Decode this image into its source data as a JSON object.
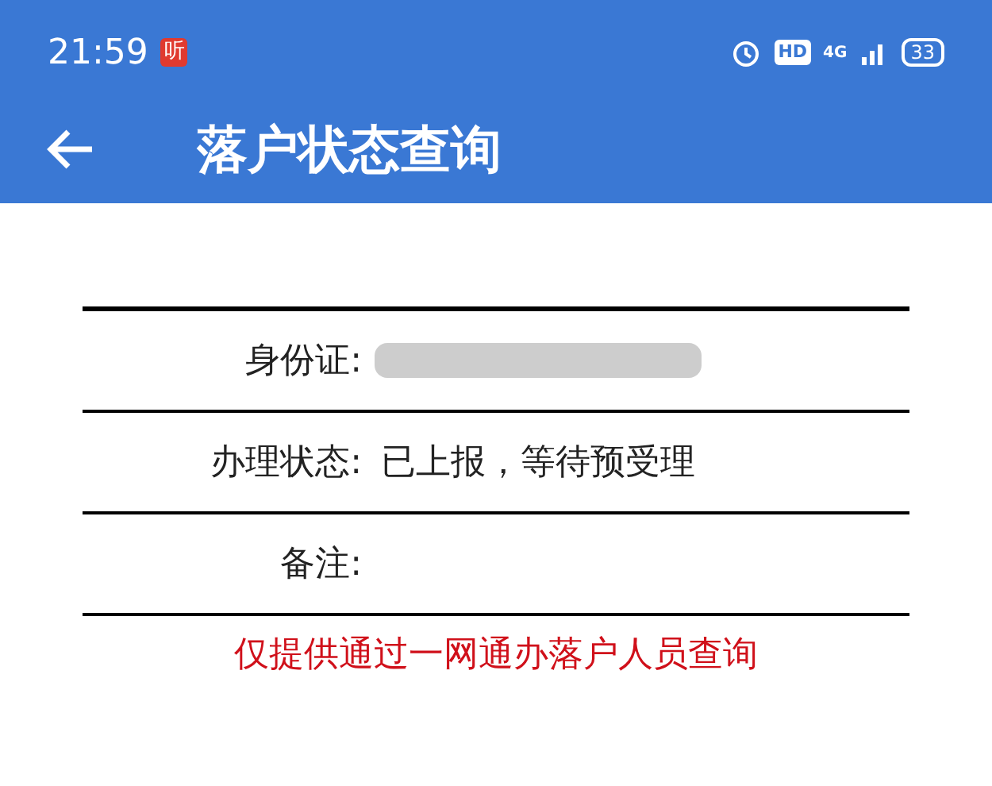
{
  "status_bar": {
    "time": "21:59",
    "app_badge": "听",
    "hd": "HD",
    "network": "4G",
    "battery": "33"
  },
  "app_bar": {
    "title": "落户状态查询"
  },
  "rows": [
    {
      "label": "身份证:",
      "value_redacted": true
    },
    {
      "label": "办理状态:",
      "value": "已上报，等待预受理",
      "value_redacted": false
    },
    {
      "label": "备注:",
      "value_redacted": false
    }
  ],
  "notice": "仅提供通过一网通办落户人员查询"
}
